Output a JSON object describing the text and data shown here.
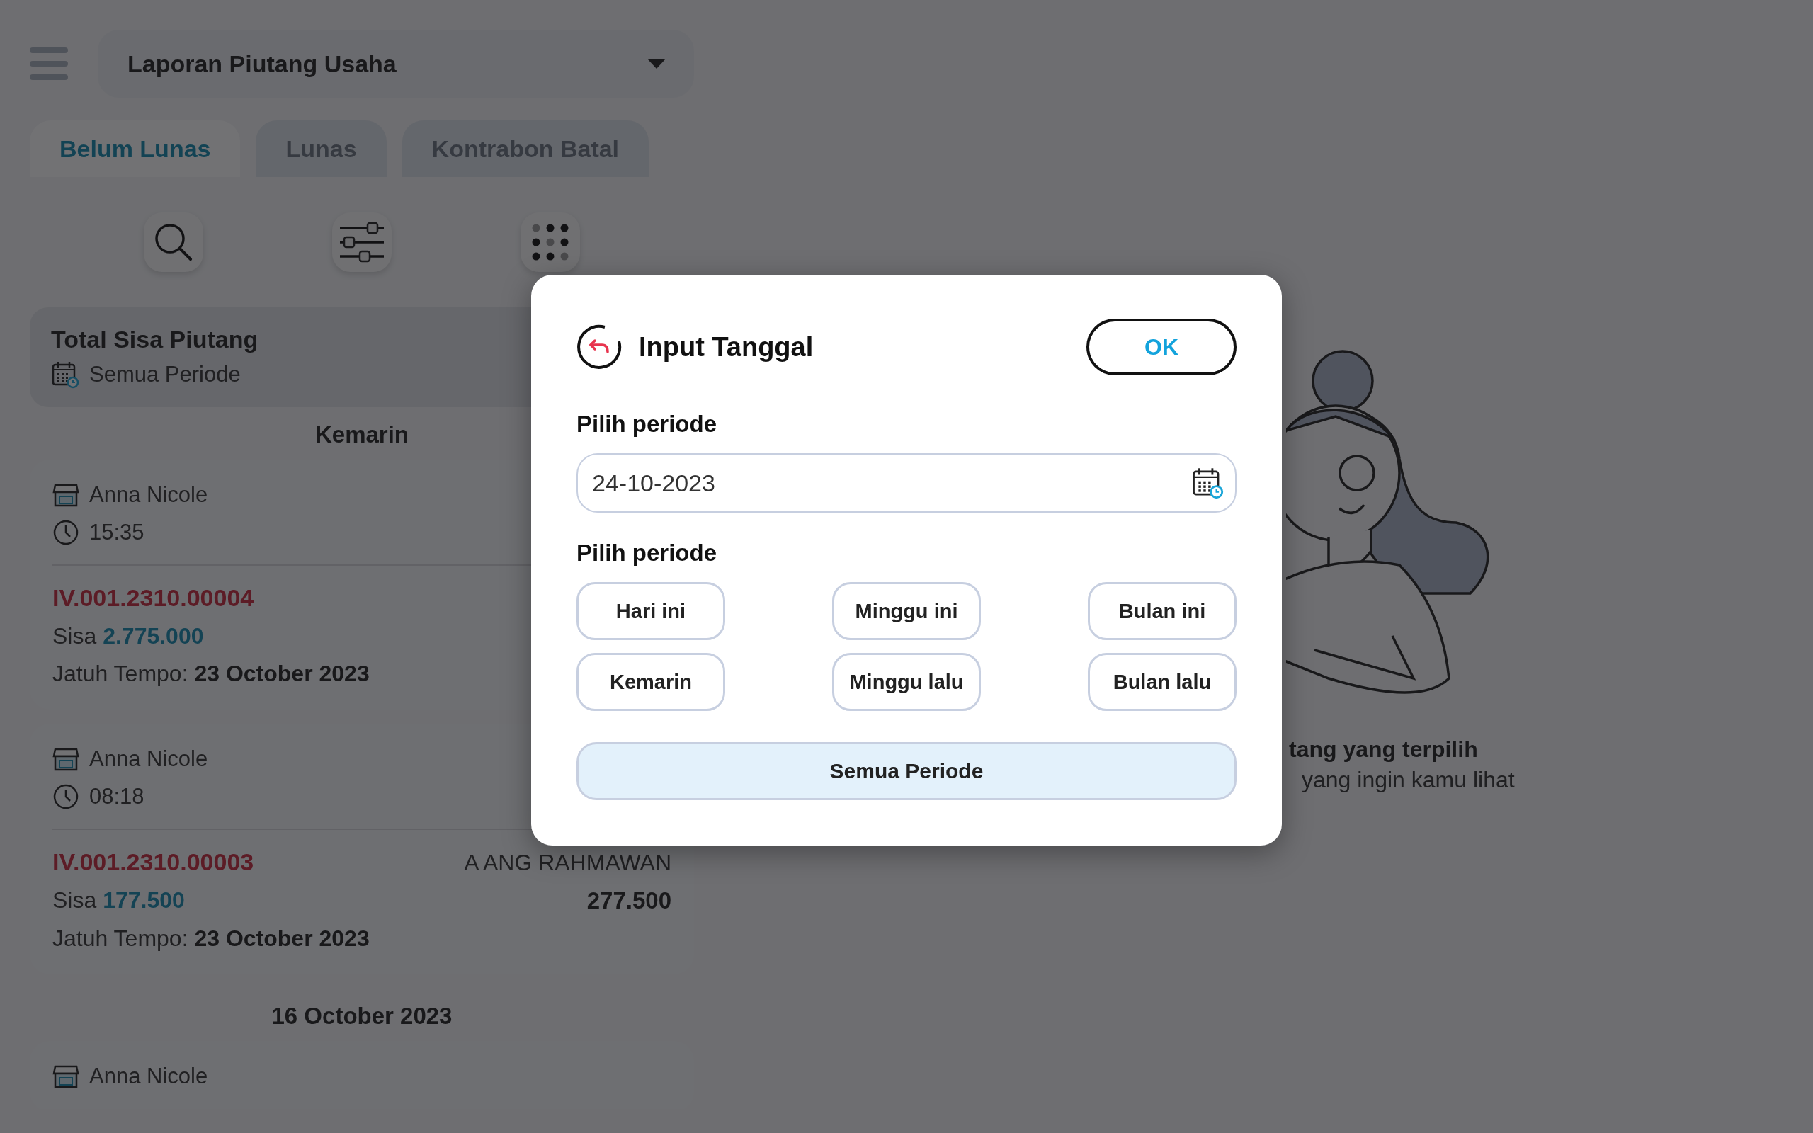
{
  "header": {
    "report_select": {
      "value": "Laporan Piutang Usaha"
    }
  },
  "tabs": [
    {
      "label": "Belum Lunas",
      "selected": true
    },
    {
      "label": "Lunas",
      "selected": false
    },
    {
      "label": "Kontrabon Batal",
      "selected": false
    }
  ],
  "summary": {
    "title": "Total Sisa Piutang",
    "period": "Semua Periode"
  },
  "groups": [
    {
      "date": "Kemarin",
      "entries": [
        {
          "customer": "Anna Nicole",
          "time": "15:35",
          "invoice": "IV.001.2310.00004",
          "remaining_label": "Sisa",
          "remaining": "2.775.000",
          "due_label": "Jatuh Tempo:",
          "due_date": "23 October 2023"
        },
        {
          "customer": "Anna Nicole",
          "time": "08:18",
          "invoice": "IV.001.2310.00003",
          "salesperson": "A ANG RAHMAWAN",
          "remaining_label": "Sisa",
          "remaining": "177.500",
          "total": "277.500",
          "due_label": "Jatuh Tempo:",
          "due_date": "23 October 2023"
        }
      ]
    },
    {
      "date": "16 October 2023",
      "entries": [
        {
          "customer": "Anna Nicole"
        }
      ]
    }
  ],
  "empty_state": {
    "title": "tang yang terpilih",
    "subtitle": "yang ingin kamu lihat"
  },
  "dialog": {
    "title": "Input Tanggal",
    "ok": "OK",
    "date_label": "Pilih periode",
    "date_value": "24-10-2023",
    "preset_label": "Pilih periode",
    "presets": [
      {
        "label": "Hari ini",
        "selected": false
      },
      {
        "label": "Minggu ini",
        "selected": false
      },
      {
        "label": "Bulan ini",
        "selected": false
      },
      {
        "label": "Kemarin",
        "selected": false
      },
      {
        "label": "Minggu lalu",
        "selected": false
      },
      {
        "label": "Bulan lalu",
        "selected": false
      }
    ],
    "all_periods": {
      "label": "Semua Periode",
      "selected": true
    }
  }
}
